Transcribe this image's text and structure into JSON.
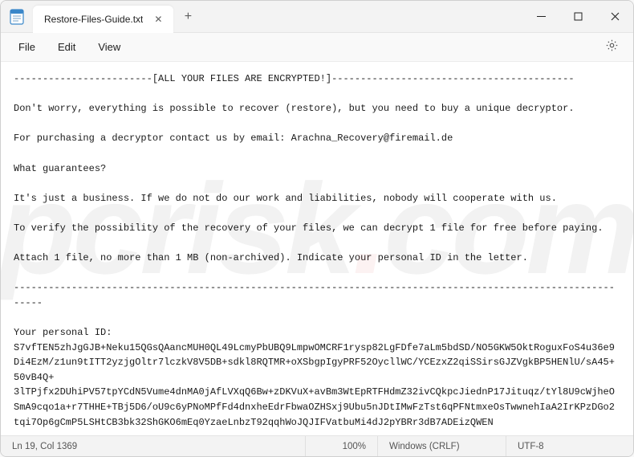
{
  "tab": {
    "title": "Restore-Files-Guide.txt",
    "close_glyph": "✕",
    "new_tab_glyph": "+"
  },
  "menu": {
    "file": "File",
    "edit": "Edit",
    "view": "View"
  },
  "document": {
    "text": "------------------------[ALL YOUR FILES ARE ENCRYPTED!]------------------------------------------\n\nDon't worry, everything is possible to recover (restore), but you need to buy a unique decryptor.\n\nFor purchasing a decryptor contact us by email: Arachna_Recovery@firemail.de\n\nWhat guarantees?\n\nIt's just a business. If we do not do our work and liabilities, nobody will cooperate with us.\n\nTo verify the possibility of the recovery of your files, we can decrypt 1 file for free before paying.\n\nAttach 1 file, no more than 1 MB (non-archived). Indicate your personal ID in the letter.\n\n-------------------------------------------------------------------------------------------------------------\n\nYour personal ID:\nS7vfTEN5zhJgGJB+Neku15QGsQAancMUH0QL49LcmyPbUBQ9LmpwOMCRF1rysp82LgFDfe7aLm5bdSD/NO5GKW5OktRoguxFoS4u36e9Di4EzM/z1un9tITT2yzjgOltr7lczkV8V5DB+sdkl8RQTMR+oXSbgpIgyPRF52OycllWC/YCEzxZ2qiSSirsGJZVgkBP5HENlU/sA45+50vB4Q+\n3lTPjfx2DUhiPV57tpYCdN5Vume4dnMA0jAfLVXqQ6Bw+zDKVuX+avBm3WtEpRTFHdmZ32ivCQkpcJiednP17Jituqz/tYl8U9cWjheOSmA9cqo1a+r7THHE+TBj5D6/oU9c6yPNoMPfFd4dnxheEdrFbwaOZHSxj9Ubu5nJDtIMwFzTst6qPFNtmxeOsTwwnehIaA2IrKPzDGo2tqi7Op6gCmP5LSHtCB3bk32ShGKO6mEq0YzaeLnbzT92qqhWoJQJIFVatbuMi4dJ2pYBRr3dB7ADEizQWEN"
  },
  "status": {
    "cursor": "Ln 19, Col 1369",
    "zoom": "100%",
    "eol": "Windows (CRLF)",
    "encoding": "UTF-8"
  }
}
